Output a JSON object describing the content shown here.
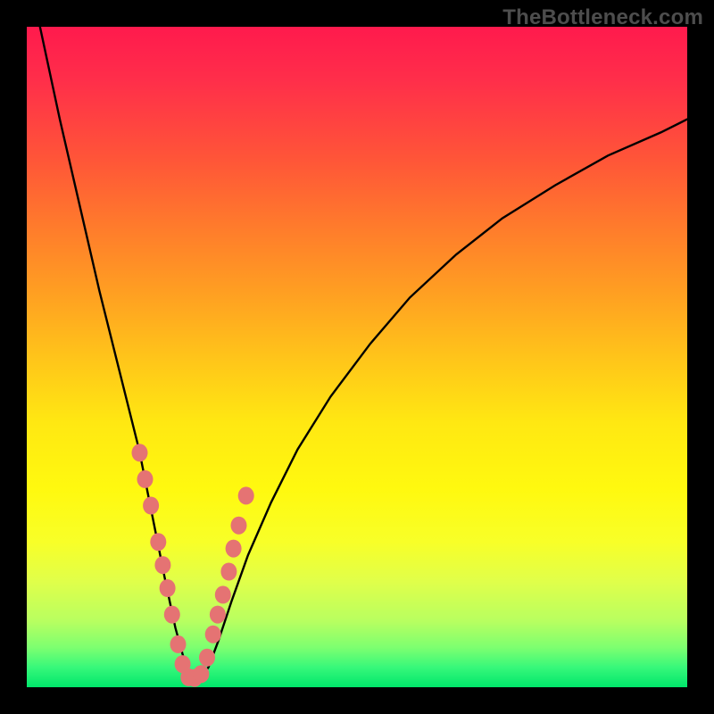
{
  "watermark": "TheBottleneck.com",
  "chart_data": {
    "type": "line",
    "title": "",
    "xlabel": "",
    "ylabel": "",
    "xlim": [
      0,
      100
    ],
    "ylim": [
      0,
      100
    ],
    "comment": "V-shaped bottleneck curve; minimum near x≈25. Values are relative (0–100) since no axis ticks are shown.",
    "x": [
      2,
      5,
      8,
      11,
      14,
      17,
      19,
      21,
      22.5,
      24,
      25,
      26,
      27.5,
      29,
      31,
      33.5,
      37,
      41,
      46,
      52,
      58,
      65,
      72,
      80,
      88,
      96,
      100
    ],
    "y": [
      100,
      86,
      73,
      60,
      48,
      36,
      26,
      16,
      9,
      3.5,
      1.2,
      1.2,
      3,
      7,
      13,
      20,
      28,
      36,
      44,
      52,
      59,
      65.5,
      71,
      76,
      80.5,
      84,
      86
    ],
    "series": [
      {
        "name": "bottleneck-curve",
        "type": "line",
        "stroke": "#000000",
        "x": [
          2,
          5,
          8,
          11,
          14,
          17,
          19,
          21,
          22.5,
          24,
          25,
          26,
          27.5,
          29,
          31,
          33.5,
          37,
          41,
          46,
          52,
          58,
          65,
          72,
          80,
          88,
          96,
          100
        ],
        "y": [
          100,
          86,
          73,
          60,
          48,
          36,
          26,
          16,
          9,
          3.5,
          1.2,
          1.2,
          3,
          7,
          13,
          20,
          28,
          36,
          44,
          52,
          59,
          65.5,
          71,
          76,
          80.5,
          84,
          86
        ]
      },
      {
        "name": "marker-dots",
        "type": "scatter",
        "color": "#e57373",
        "x": [
          17.1,
          17.9,
          18.8,
          19.9,
          20.6,
          21.3,
          22.0,
          22.9,
          23.6,
          24.5,
          25.4,
          26.4,
          27.3,
          28.2,
          28.9,
          29.7,
          30.6,
          31.3,
          32.1,
          33.2
        ],
        "y": [
          35.5,
          31.5,
          27.5,
          22.0,
          18.5,
          15.0,
          11.0,
          6.5,
          3.5,
          1.5,
          1.4,
          2.0,
          4.5,
          8.0,
          11.0,
          14.0,
          17.5,
          21.0,
          24.5,
          29.0
        ]
      }
    ]
  }
}
